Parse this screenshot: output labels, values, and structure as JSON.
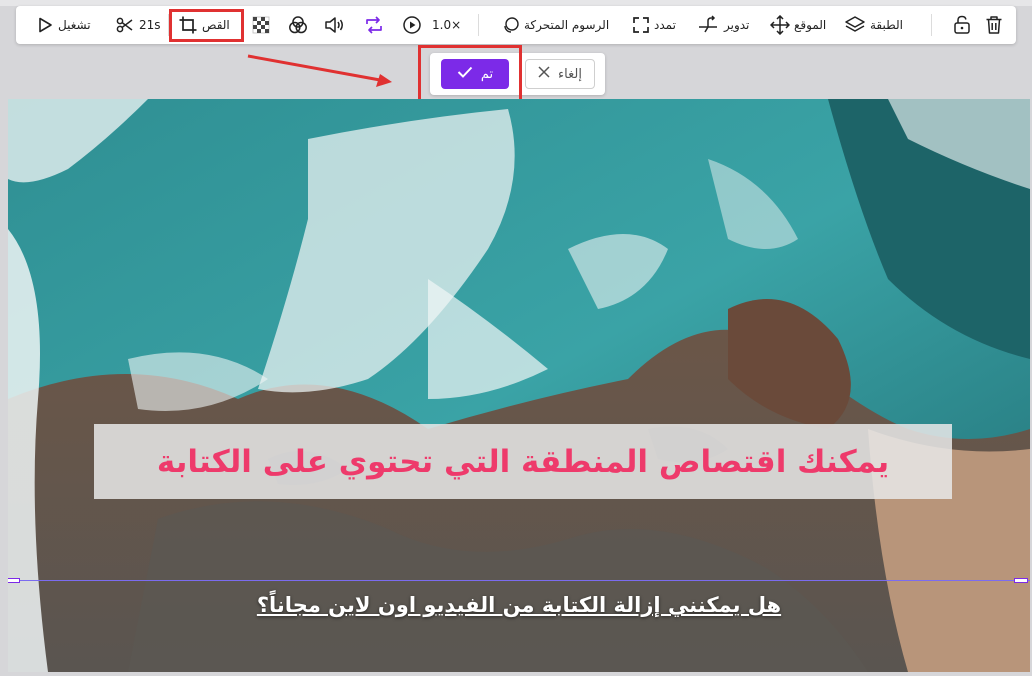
{
  "toolbar": {
    "play_label": "تشغيل",
    "duration_label": "21s",
    "crop_label": "القص",
    "speed_label": "1.0×",
    "animations_label": "الرسوم المتحركة",
    "stretch_label": "تمدد",
    "rotate_label": "تدوير",
    "position_label": "الموقع",
    "layer_label": "الطبقة"
  },
  "confirm": {
    "done_label": "تم",
    "cancel_label": "إلغاء"
  },
  "canvas": {
    "caption_text": "يمكنك اقتصاص المنطقة التي تحتوي على الكتابة",
    "subtitle_text": "هل يمكنني إزالة الكتابة من الفيديو اون لاين مجاناً؟"
  },
  "colors": {
    "accent": "#7c2ae8",
    "highlight": "#e03131",
    "caption": "#ee3a6b"
  }
}
